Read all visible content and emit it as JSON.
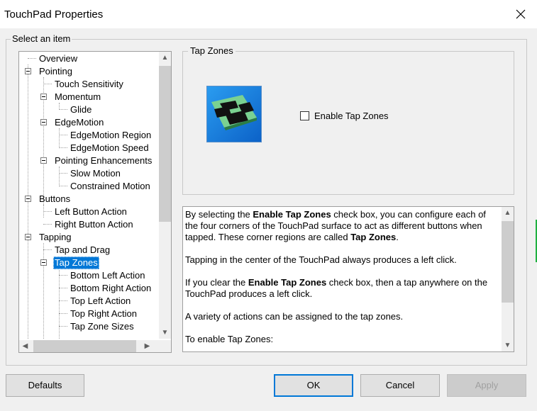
{
  "window": {
    "title": "TouchPad Properties"
  },
  "tree": {
    "label": "Select an item",
    "items": [
      {
        "label": "Overview",
        "level": 0,
        "expander": false
      },
      {
        "label": "Pointing",
        "level": 0,
        "expander": true
      },
      {
        "label": "Touch Sensitivity",
        "level": 1,
        "expander": false
      },
      {
        "label": "Momentum",
        "level": 1,
        "expander": true
      },
      {
        "label": "Glide",
        "level": 2,
        "expander": false
      },
      {
        "label": "EdgeMotion",
        "level": 1,
        "expander": true
      },
      {
        "label": "EdgeMotion Region",
        "level": 2,
        "expander": false
      },
      {
        "label": "EdgeMotion Speed",
        "level": 2,
        "expander": false
      },
      {
        "label": "Pointing Enhancements",
        "level": 1,
        "expander": true
      },
      {
        "label": "Slow Motion",
        "level": 2,
        "expander": false
      },
      {
        "label": "Constrained Motion",
        "level": 2,
        "expander": false
      },
      {
        "label": "Buttons",
        "level": 0,
        "expander": true
      },
      {
        "label": "Left Button Action",
        "level": 1,
        "expander": false
      },
      {
        "label": "Right Button Action",
        "level": 1,
        "expander": false
      },
      {
        "label": "Tapping",
        "level": 0,
        "expander": true
      },
      {
        "label": "Tap and Drag",
        "level": 1,
        "expander": false
      },
      {
        "label": "Tap Zones",
        "level": 1,
        "expander": true,
        "selected": true
      },
      {
        "label": "Bottom Left Action",
        "level": 2,
        "expander": false
      },
      {
        "label": "Bottom Right Action",
        "level": 2,
        "expander": false
      },
      {
        "label": "Top Left Action",
        "level": 2,
        "expander": false
      },
      {
        "label": "Top Right Action",
        "level": 2,
        "expander": false
      },
      {
        "label": "Tap Zone Sizes",
        "level": 2,
        "expander": false
      }
    ]
  },
  "tap_zones": {
    "group_label": "Tap Zones",
    "checkbox_label": "Enable Tap Zones",
    "checked": false
  },
  "help": {
    "p1_a": "By selecting the ",
    "p1_b": "Enable Tap Zones",
    "p1_c": " check box, you can configure each of the four corners of the TouchPad surface to act as different buttons when tapped. These corner regions are called ",
    "p1_d": "Tap Zones",
    "p1_e": ".",
    "p2": "Tapping in the center of the TouchPad always produces a left click.",
    "p3_a": "If you clear the ",
    "p3_b": "Enable Tap Zones",
    "p3_c": " check box, then a tap anywhere on the TouchPad produces a left click.",
    "p4": "A variety of actions can be assigned to the tap zones.",
    "p5": "To enable Tap Zones:"
  },
  "buttons": {
    "defaults": "Defaults",
    "ok": "OK",
    "cancel": "Cancel",
    "apply": "Apply"
  },
  "colors": {
    "selection": "#0078d7",
    "accent_strip": "#1fb141"
  }
}
